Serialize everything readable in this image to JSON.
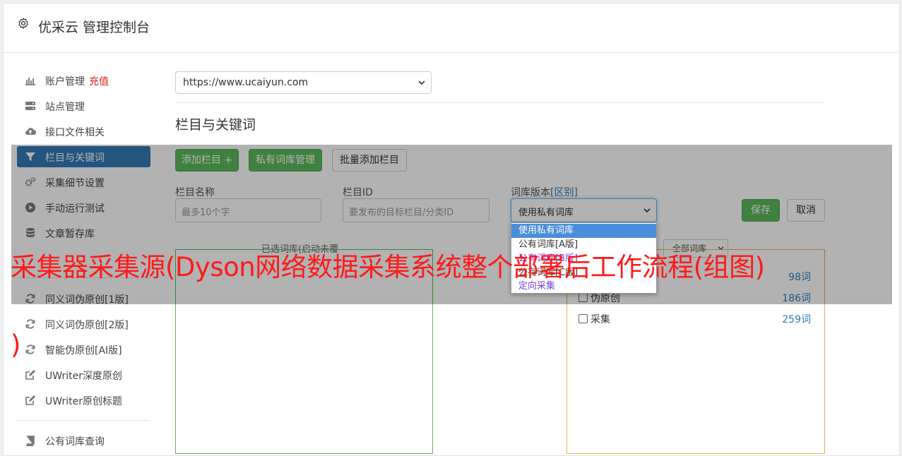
{
  "header": {
    "title": "优采云 管理控制台",
    "icon": "gear-icon"
  },
  "sidebar": {
    "items": [
      {
        "label": "账户管理",
        "extra": "充值",
        "icon": "bar-chart-icon"
      },
      {
        "label": "站点管理",
        "icon": "server-icon"
      },
      {
        "label": "接口文件相关",
        "icon": "cloud-upload-icon"
      },
      {
        "label": "栏目与关键词",
        "icon": "filter-icon",
        "active": true
      },
      {
        "label": "采集细节设置",
        "icon": "cogs-icon"
      },
      {
        "label": "手动运行测试",
        "icon": "play-circle-icon"
      },
      {
        "label": "文章暂存库",
        "icon": "database-icon"
      },
      {
        "label": "同义词伪原创[1版]",
        "icon": "refresh-icon"
      },
      {
        "label": "同义词伪原创[2版]",
        "icon": "refresh-icon"
      },
      {
        "label": "智能伪原创[AI版]",
        "icon": "refresh-icon"
      },
      {
        "label": "UWriter深度原创",
        "icon": "edit-icon"
      },
      {
        "label": "UWriter原创标题",
        "icon": "edit-icon"
      },
      {
        "label": "公有词库查询",
        "icon": "book-icon"
      }
    ]
  },
  "main": {
    "site_select": "https://www.ucaiyun.com",
    "section_title": "栏目与关键词",
    "buttons": {
      "add_column": "添加栏目 +",
      "private_lexicon": "私有词库管理",
      "batch_add": "批量添加栏目",
      "save": "保存",
      "cancel": "取消"
    },
    "fields": {
      "column_name_label": "栏目名称",
      "column_name_placeholder": "最多10个字",
      "column_id_label": "栏目ID",
      "column_id_placeholder": "要发布的目标栏目/分类ID",
      "lexicon_version_label": "词库版本",
      "lexicon_version_link": "[区别]",
      "lexicon_version_value": "使用私有词库"
    },
    "dropdown_options": [
      "使用私有词库",
      "公有词库[A版]",
      "公有词库[B版]",
      "公有词库[C版]",
      "定向采集"
    ],
    "selected_caption": "已选词库(启动未覆",
    "filter_select": "全部词库",
    "lexicons": [
      {
        "label": "伪原创",
        "count": "186词"
      },
      {
        "label": "采集",
        "count": "259词"
      }
    ],
    "top_count": "98词"
  },
  "banner": {
    "line1": "采集器采集源(Dyson网络数据采集系统整个部署后工作流程(组图)",
    "line2": ")"
  },
  "colors": {
    "accent": "#337ab7",
    "success": "#5cb85c",
    "banner": "#ff1a1a"
  }
}
